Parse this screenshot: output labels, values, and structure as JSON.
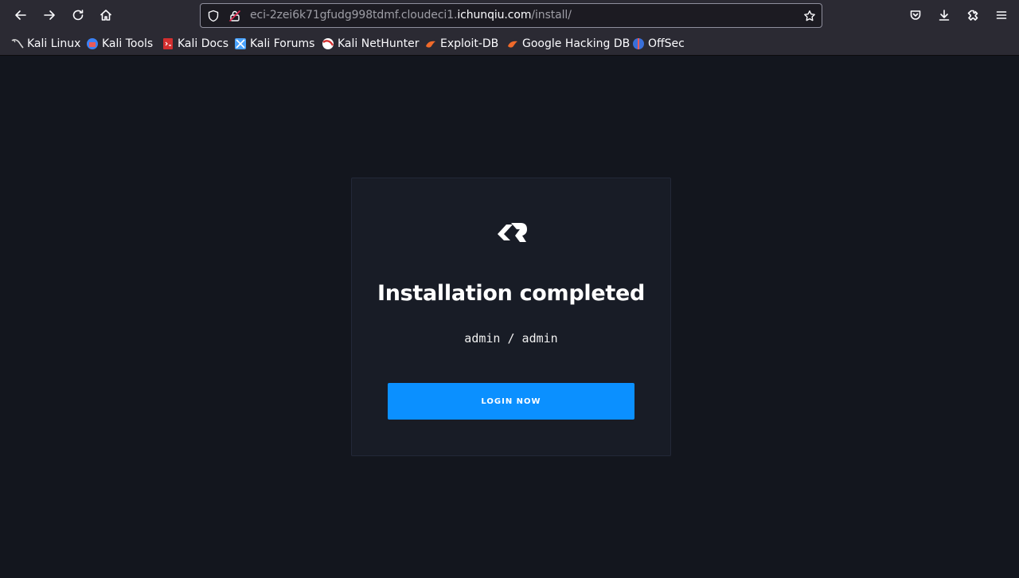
{
  "browser": {
    "url_prefix": "eci-2zei6k71gfudg998tdmf.cloudeci1.",
    "url_host": "ichunqiu.com",
    "url_path": "/install/",
    "bookmarks": [
      {
        "label": "Kali Linux",
        "icon": "kali-linux-icon",
        "color": "#2b2a33"
      },
      {
        "label": "Kali Tools",
        "icon": "kali-tools-icon",
        "color": "#3b82f6"
      },
      {
        "label": "Kali Docs",
        "icon": "kali-docs-icon",
        "color": "#d32f2f"
      },
      {
        "label": "Kali Forums",
        "icon": "kali-forums-icon",
        "color": "#4aa3ff"
      },
      {
        "label": "Kali NetHunter",
        "icon": "kali-nethunter-icon",
        "color": "#d32f2f"
      },
      {
        "label": "Exploit-DB",
        "icon": "exploit-db-icon",
        "color": "#f06a2a"
      },
      {
        "label": "Google Hacking DB",
        "icon": "ghdb-icon",
        "color": "#f06a2a"
      },
      {
        "label": "OffSec",
        "icon": "offsec-icon",
        "color": "#3a6fd8"
      }
    ]
  },
  "page": {
    "title": "Installation completed",
    "credentials": "admin / admin",
    "login_label": "LOGIN NOW"
  },
  "colors": {
    "accent": "#0b90ff",
    "page_bg": "#13161e",
    "card_bg": "#181c26"
  }
}
